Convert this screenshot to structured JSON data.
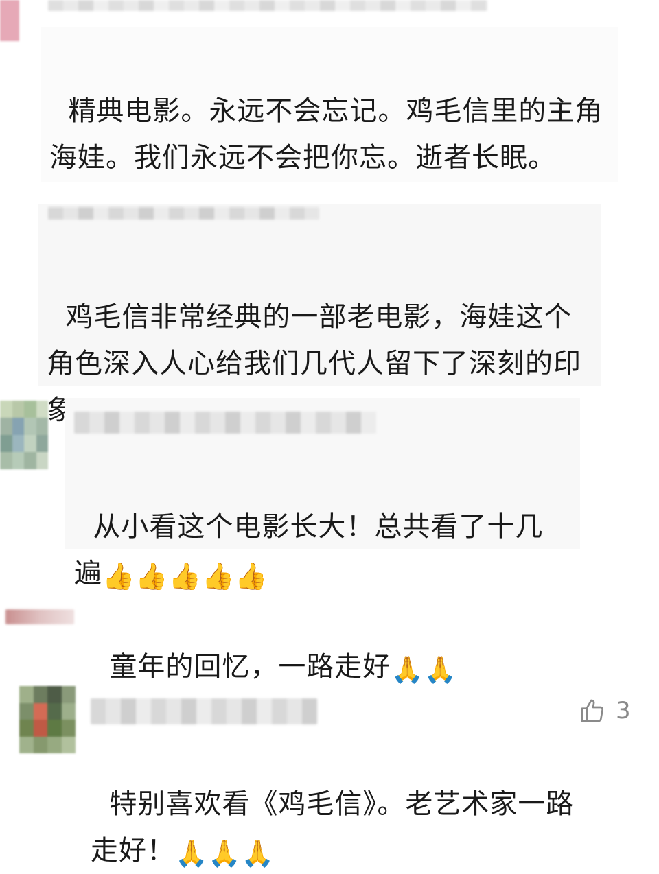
{
  "comments": [
    {
      "text": "精典电影。永远不会忘记。鸡毛信里的主角海娃。我们永远不会把你忘。逝者长眠。",
      "emojis": ""
    },
    {
      "text": "鸡毛信非常经典的一部老电影，海娃这个角色深入人心给我们几代人留下了深刻的印象",
      "emojis": "👍👍👍❤❤❤"
    },
    {
      "text": "从小看这个电影长大！总共看了十几遍",
      "emojis": "👍👍👍👍👍"
    },
    {
      "text": "童年的回忆，一路走好",
      "emojis": "🙏🙏"
    },
    {
      "text": "特别喜欢看《鸡毛信》。老艺术家一路走好！",
      "emojis": "🙏🙏🙏",
      "like_count": "3"
    }
  ],
  "icons": {
    "like": "thumbs-up-outline-icon"
  }
}
